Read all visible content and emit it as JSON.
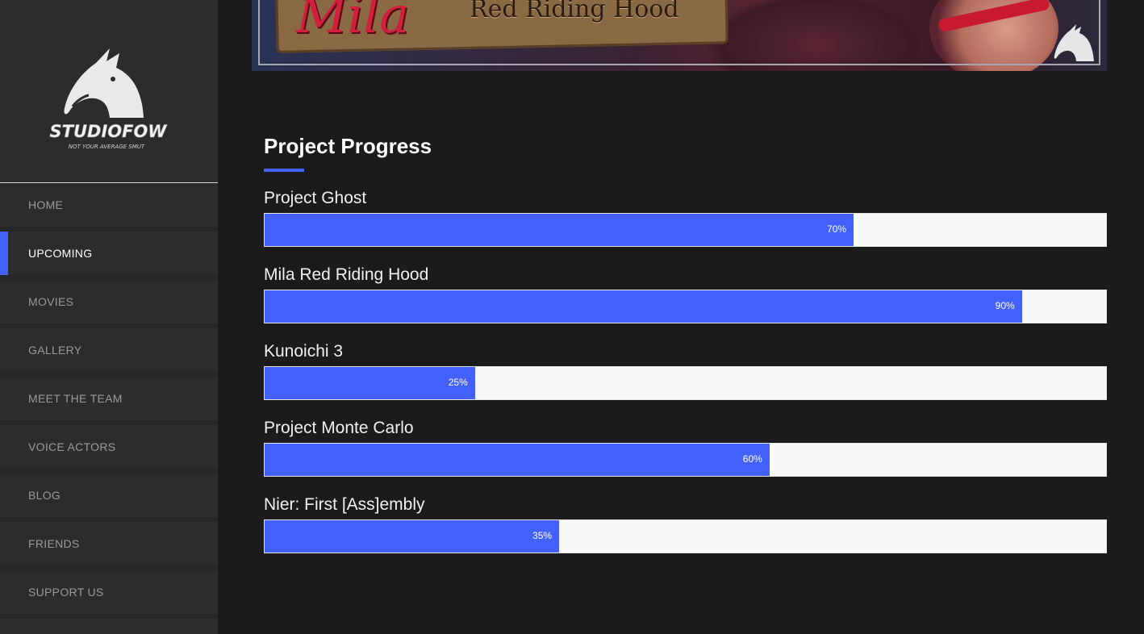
{
  "brand": {
    "logo_name": "STUDIOFOW",
    "tagline": "NOT YOUR AVERAGE SMUT"
  },
  "banner": {
    "script_text": "Mila",
    "title": "Red Riding Hood"
  },
  "nav": {
    "items": [
      {
        "label": "HOME",
        "active": false
      },
      {
        "label": "UPCOMING",
        "active": true
      },
      {
        "label": "MOVIES",
        "active": false
      },
      {
        "label": "GALLERY",
        "active": false
      },
      {
        "label": "MEET THE TEAM",
        "active": false
      },
      {
        "label": "VOICE ACTORS",
        "active": false
      },
      {
        "label": "BLOG",
        "active": false
      },
      {
        "label": "FRIENDS",
        "active": false
      },
      {
        "label": "SUPPORT US",
        "active": false
      }
    ]
  },
  "section": {
    "title": "Project Progress"
  },
  "projects": [
    {
      "name": "Project Ghost",
      "percent": 70,
      "label": "70%"
    },
    {
      "name": "Mila Red Riding Hood",
      "percent": 90,
      "label": "90%"
    },
    {
      "name": "Kunoichi 3",
      "percent": 25,
      "label": "25%"
    },
    {
      "name": "Project Monte Carlo",
      "percent": 60,
      "label": "60%"
    },
    {
      "name": "Nier: First [Ass]embly",
      "percent": 35,
      "label": "35%"
    }
  ],
  "colors": {
    "accent": "#4361ff",
    "sidebar_bg": "#2c2c2c",
    "page_bg": "#1b1b1b",
    "track_bg": "#f8f8f8"
  }
}
